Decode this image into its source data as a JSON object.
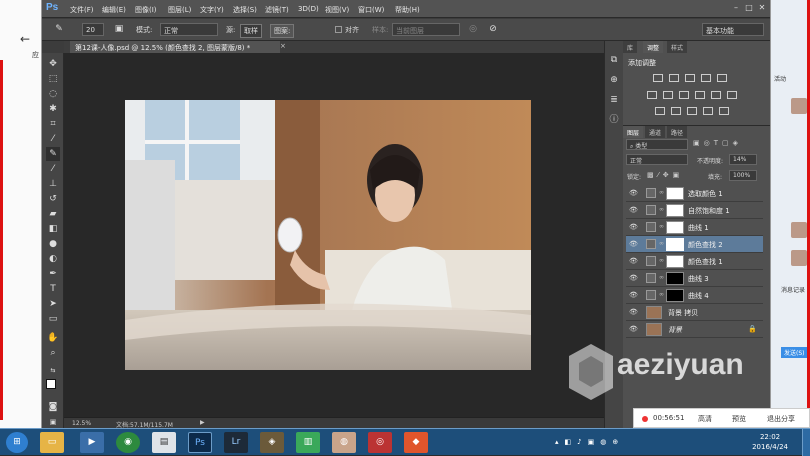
{
  "photoshop": {
    "logo": "Ps",
    "menus": [
      "文件(F)",
      "编辑(E)",
      "图像(I)",
      "图层(L)",
      "文字(Y)",
      "选择(S)",
      "滤镜(T)",
      "3D(D)",
      "视图(V)",
      "窗口(W)",
      "帮助(H)"
    ],
    "options": {
      "brush_size": "20",
      "mode_label": "模式:",
      "mode_value": "正常",
      "source_label": "源:",
      "source_sampled": "取样",
      "source_pattern": "图案:",
      "align_label": "对齐",
      "sample_label": "样本:",
      "sample_value": "当前图层",
      "workspace": "基本功能"
    },
    "document_tab": "第12课-人像.psd @ 12.5% (颜色查找 2, 图层蒙版/8) *",
    "status": {
      "zoom": "12.5%",
      "doc_size": "文档:57.1M/115.7M"
    },
    "panel_tabs_top": [
      "库",
      "调整",
      "样式"
    ],
    "adjustments_title": "添加调整",
    "panel_tabs_layers": [
      "图层",
      "通道",
      "路径"
    ],
    "layers_filter": "类型",
    "blend_mode": "正常",
    "opacity_label": "不透明度:",
    "opacity_value": "14%",
    "lock_label": "锁定:",
    "fill_label": "填充:",
    "fill_value": "100%",
    "layers": [
      {
        "name": "选取颜色 1"
      },
      {
        "name": "自然饱和度 1"
      },
      {
        "name": "曲线 1"
      },
      {
        "name": "颜色查找 2"
      },
      {
        "name": "颜色查找 1"
      },
      {
        "name": "曲线 3"
      },
      {
        "name": "曲线 4"
      },
      {
        "name": "背景 拷贝"
      },
      {
        "name": "背景"
      }
    ]
  },
  "recorder": {
    "time": "00:56:51",
    "hd": "高清",
    "preview": "预览",
    "exit_share": "退出分享"
  },
  "watermark": "aeziyuan",
  "chat": {
    "label1": "活动",
    "label2": "消息记录",
    "label3": "发送(S)"
  },
  "browser": {
    "label1": "应"
  },
  "taskbar": {
    "time": "22:02",
    "date": "2016/4/24"
  }
}
